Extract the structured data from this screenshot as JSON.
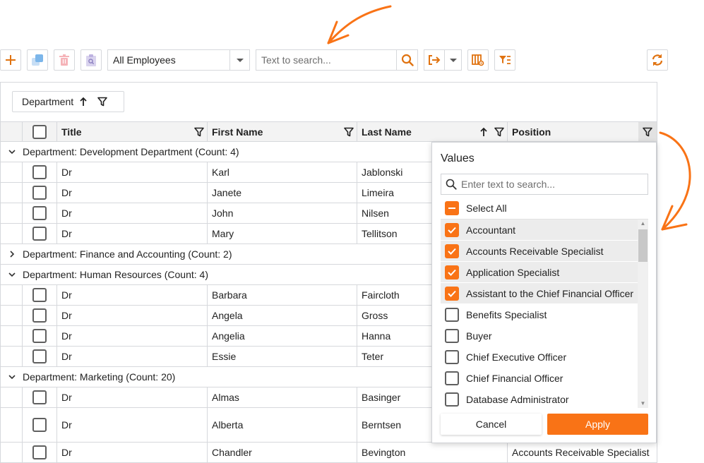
{
  "toolbar": {
    "icons": [
      "plus-icon",
      "copy-icon",
      "delete-icon",
      "preview-icon"
    ],
    "view_selector": {
      "value": "All Employees"
    },
    "search": {
      "placeholder": "Text to search...",
      "value": ""
    },
    "export_icon": "export-icon",
    "column_chooser_icon": "column-chooser-icon",
    "filter_editor_icon": "filter-editor-icon",
    "refresh_icon": "refresh-icon"
  },
  "accent_color": "#f97316",
  "group_panel": {
    "chip_label": "Department",
    "sort": "ascending"
  },
  "columns": [
    {
      "label": "Title"
    },
    {
      "label": "First Name"
    },
    {
      "label": "Last Name",
      "sort": "ascending"
    },
    {
      "label": "Position"
    }
  ],
  "groups": [
    {
      "label": "Department: Development Department (Count: 4)",
      "expanded": true,
      "rows": [
        {
          "title": "Dr",
          "first": "Karl",
          "last": "Jablonski",
          "position": ""
        },
        {
          "title": "Dr",
          "first": "Janete",
          "last": "Limeira",
          "position": ""
        },
        {
          "title": "Dr",
          "first": "John",
          "last": "Nilsen",
          "position": ""
        },
        {
          "title": "Dr",
          "first": "Mary",
          "last": "Tellitson",
          "position": ""
        }
      ]
    },
    {
      "label": "Department: Finance and Accounting (Count: 2)",
      "expanded": false,
      "rows": []
    },
    {
      "label": "Department: Human Resources (Count: 4)",
      "expanded": true,
      "rows": [
        {
          "title": "Dr",
          "first": "Barbara",
          "last": "Faircloth",
          "position": ""
        },
        {
          "title": "Dr",
          "first": "Angela",
          "last": "Gross",
          "position": ""
        },
        {
          "title": "Dr",
          "first": "Angelia",
          "last": "Hanna",
          "position": ""
        },
        {
          "title": "Dr",
          "first": "Essie",
          "last": "Teter",
          "position": ""
        }
      ]
    },
    {
      "label": "Department: Marketing (Count: 20)",
      "expanded": true,
      "rows": [
        {
          "title": "Dr",
          "first": "Almas",
          "last": "Basinger",
          "position": ""
        },
        {
          "title": "Dr",
          "first": "Alberta",
          "last": "Berntsen",
          "position": ""
        },
        {
          "title": "Dr",
          "first": "Chandler",
          "last": "Bevington",
          "position": "Accounts Receivable Specialist"
        }
      ]
    }
  ],
  "filter_popup": {
    "title": "Values",
    "search_placeholder": "Enter text to search...",
    "select_all_label": "Select All",
    "select_all_state": "indeterminate",
    "values": [
      {
        "label": "Accountant",
        "checked": true
      },
      {
        "label": "Accounts Receivable Specialist",
        "checked": true
      },
      {
        "label": "Application Specialist",
        "checked": true
      },
      {
        "label": "Assistant to the Chief Financial Officer",
        "checked": true
      },
      {
        "label": "Benefits Specialist",
        "checked": false
      },
      {
        "label": "Buyer",
        "checked": false
      },
      {
        "label": "Chief Executive Officer",
        "checked": false
      },
      {
        "label": "Chief Financial Officer",
        "checked": false
      },
      {
        "label": "Database Administrator",
        "checked": false
      }
    ],
    "cancel_label": "Cancel",
    "apply_label": "Apply"
  }
}
